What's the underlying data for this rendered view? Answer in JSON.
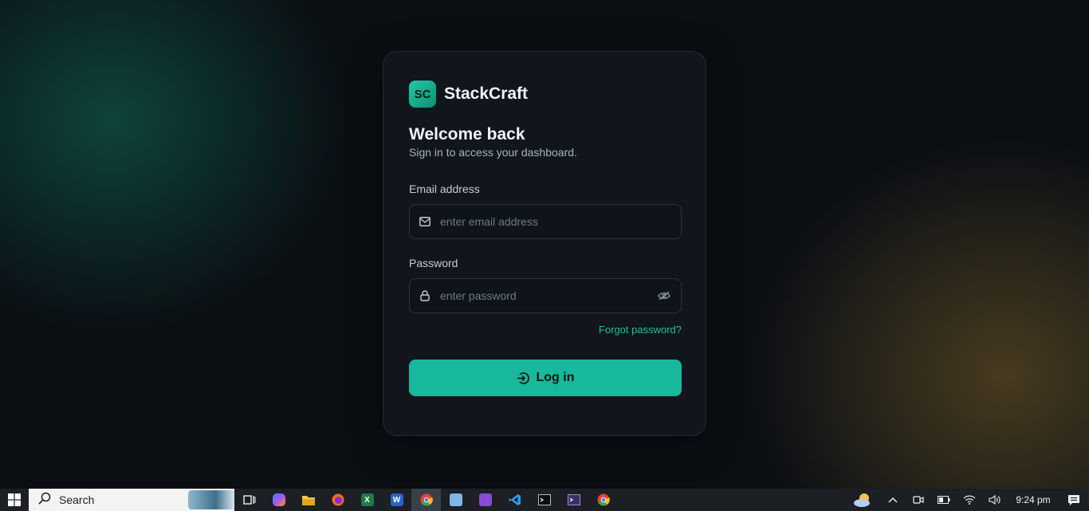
{
  "brand": {
    "logo_text": "SC",
    "name": "StackCraft"
  },
  "login": {
    "title": "Welcome back",
    "subtitle": "Sign in to access your dashboard.",
    "email_label": "Email address",
    "email_placeholder": "enter email address",
    "email_value": "",
    "password_label": "Password",
    "password_placeholder": "enter password",
    "password_value": "",
    "forgot_label": "Forgot password?",
    "login_label": "Log in"
  },
  "taskbar": {
    "search_label": "Search",
    "apps": [
      "task-view",
      "copilot",
      "file-explorer",
      "firefox",
      "excel",
      "word",
      "chrome",
      "notepad",
      "visual-studio",
      "vscode",
      "terminal",
      "terminal-2",
      "chrome-2"
    ],
    "active_app": "chrome",
    "clock": "9:24 pm"
  },
  "colors": {
    "accent": "#17b89b",
    "link": "#1fbf97",
    "card": "#11161d",
    "background": "#0b0f14"
  }
}
